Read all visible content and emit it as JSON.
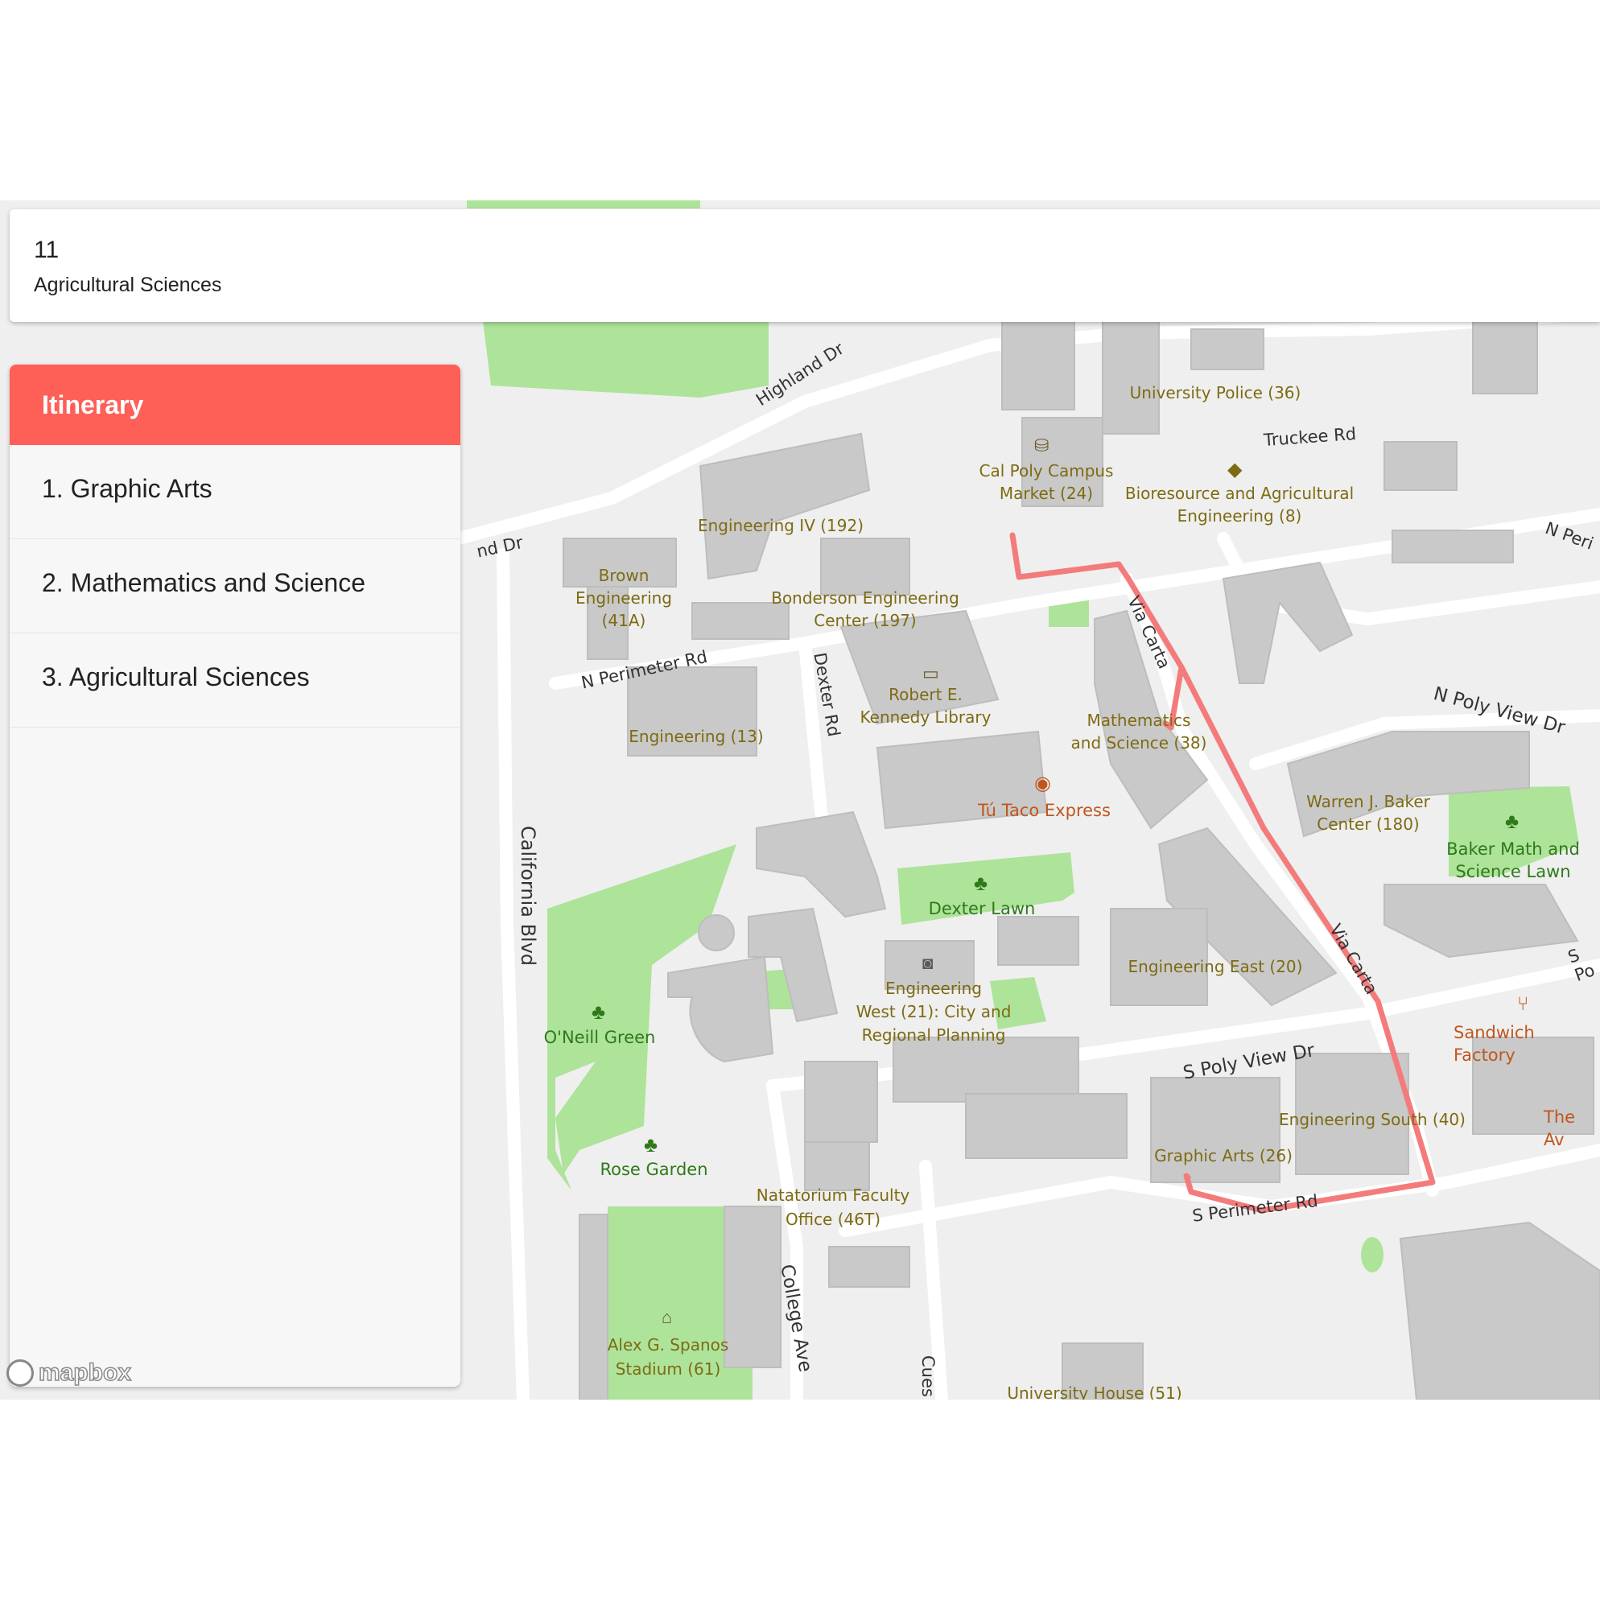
{
  "header": {
    "number": "11",
    "subtitle": "Agricultural Sciences"
  },
  "itinerary": {
    "title": "Itinerary",
    "items": [
      {
        "label": "1. Graphic Arts"
      },
      {
        "label": "2. Mathematics and Science"
      },
      {
        "label": "3. Agricultural Sciences"
      }
    ]
  },
  "map": {
    "route_color": "#f47b7b",
    "building_labels": [
      "University Police (36)",
      "Cal Poly Campus",
      "Market (24)",
      "Bioresource and Agricultural",
      "Engineering (8)",
      "Engineering IV (192)",
      "Brown",
      "Engineering",
      "(41A)",
      "Bonderson Engineering",
      "Center (197)",
      "Robert E.",
      "Kennedy Library",
      "Engineering (13)",
      "Mathematics",
      "and Science (38)",
      "Warren J. Baker",
      "Center (180)",
      "Engineering East (20)",
      "Engineering",
      "West (21): City and",
      "Regional Planning",
      "Engineering South (40)",
      "Graphic Arts (26)",
      "Natatorium Faculty",
      "Office (46T)",
      "Alex G. Spanos",
      "Stadium (61)",
      "University House (51)"
    ],
    "park_labels": [
      "Dexter Lawn",
      "O'Neill Green",
      "Rose Garden",
      "Baker Math and",
      "Science Lawn"
    ],
    "poi_labels": [
      "Tú Taco Express",
      "Sandwich Factory",
      "The Av"
    ],
    "street_labels": [
      "Highland Dr",
      "Truckee Rd",
      "N Perimeter Rd",
      "Dexter Rd",
      "California Blvd",
      "Via Carta",
      "Via Carta",
      "N Poly View Dr",
      "S Poly View Dr",
      "S Perimeter Rd",
      "College Ave",
      "nd Dr",
      "N Peri",
      "S Po",
      "Cues"
    ],
    "attribution": "mapbox"
  }
}
